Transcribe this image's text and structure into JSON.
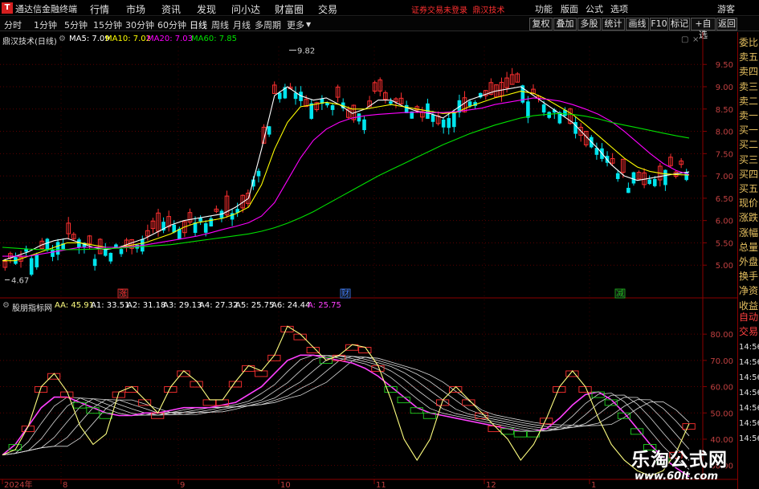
{
  "app": {
    "title": "通达信金融终端",
    "menus": [
      "行情",
      "市场",
      "资讯",
      "发现",
      "问小达",
      "财富圈",
      "交易"
    ],
    "notice": "证券交易未登录",
    "brand": "鼎汉技术",
    "right_menus": [
      "功能",
      "版面",
      "公式",
      "选项"
    ],
    "user": "游客"
  },
  "toolbar": {
    "periods": [
      "分时",
      "1分钟",
      "5分钟",
      "15分钟",
      "30分钟",
      "60分钟",
      "日线",
      "周线",
      "月线",
      "多周期",
      "更多"
    ],
    "active_period": "日线",
    "right_buttons": [
      "复权",
      "叠加",
      "多股",
      "统计",
      "画线",
      "F10",
      "标记",
      "+自选",
      "返回"
    ]
  },
  "kline": {
    "name": "鼎汉技术(日线)",
    "ma": [
      {
        "label": "MA5: 7.09",
        "color": "#ffffff"
      },
      {
        "label": "MA10: 7.02",
        "color": "#ffff00"
      },
      {
        "label": "MA20: 7.03",
        "color": "#ff00ff"
      },
      {
        "label": "MA60: 7.85",
        "color": "#00e000"
      }
    ],
    "price_ticks": [
      "9.50",
      "9.00",
      "8.50",
      "8.00",
      "7.50",
      "7.00",
      "6.50",
      "6.00",
      "5.50",
      "5.00"
    ],
    "high_label": "9.82",
    "low_label": "4.67",
    "markers": [
      {
        "text": "涨",
        "color": "#ff3030"
      },
      {
        "text": "财",
        "color": "#4080ff"
      },
      {
        "text": "减",
        "color": "#20c020"
      }
    ]
  },
  "indicator": {
    "name": "股朋指标网",
    "lines": [
      {
        "label": "AA: 45.91",
        "color": "#ffff80"
      },
      {
        "label": "A1: 33.51",
        "color": "#ffffff"
      },
      {
        "label": "A2: 31.18",
        "color": "#ffffff"
      },
      {
        "label": "A3: 29.13",
        "color": "#ffffff"
      },
      {
        "label": "A4: 27.32",
        "color": "#ffffff"
      },
      {
        "label": "A5: 25.75",
        "color": "#ffffff"
      },
      {
        "label": "A6: 24.44",
        "color": "#ffffff"
      },
      {
        "label": "A: 25.75",
        "color": "#ff40ff"
      }
    ],
    "ticks": [
      "80.00",
      "70.00",
      "60.00",
      "50.00",
      "40.00",
      "30.00"
    ]
  },
  "x_axis": {
    "labels": [
      "2024年",
      "8",
      "9",
      "10",
      "11",
      "12",
      "1"
    ]
  },
  "side_panel": {
    "items": [
      "委比",
      "卖五",
      "卖四",
      "卖三",
      "卖二",
      "卖一",
      "买一",
      "买二",
      "买三",
      "买四",
      "买五",
      "现价",
      "涨跌",
      "涨幅",
      "总量",
      "外盘",
      "换手",
      "净资",
      "收益",
      "自动",
      "交易"
    ],
    "times": [
      "14:56",
      "14:56",
      "14:56",
      "14:56",
      "14:56",
      "14:56",
      "14:56"
    ]
  },
  "watermark": {
    "title": "乐淘公式网",
    "url": "www.60lt.com"
  },
  "chart_data": [
    {
      "type": "candlestick",
      "title": "鼎汉技术(日线)",
      "yrange": [
        4.5,
        9.9
      ],
      "x_labels": [
        "2024年",
        "8",
        "9",
        "10",
        "11",
        "12",
        "1"
      ],
      "high": 9.82,
      "low": 4.67,
      "series": [
        {
          "name": "MA5",
          "last": 7.09,
          "color": "#ffffff",
          "values": [
            5.1,
            5.2,
            5.3,
            5.45,
            5.55,
            5.6,
            5.5,
            5.4,
            5.35,
            5.4,
            5.5,
            5.6,
            5.75,
            5.9,
            6.0,
            6.05,
            6.1,
            6.15,
            6.3,
            6.5,
            7.6,
            8.8,
            9.0,
            8.8,
            8.7,
            8.75,
            8.6,
            8.4,
            8.5,
            8.7,
            8.7,
            8.55,
            8.45,
            8.4,
            8.3,
            8.5,
            8.7,
            8.8,
            8.9,
            8.95,
            9.0,
            8.8,
            8.6,
            8.4,
            8.2,
            7.9,
            7.6,
            7.25,
            7.0,
            6.9,
            6.95,
            7.0,
            7.05,
            7.09
          ]
        },
        {
          "name": "MA10",
          "last": 7.02,
          "color": "#ffff00",
          "values": [
            5.1,
            5.1,
            5.2,
            5.3,
            5.4,
            5.5,
            5.5,
            5.45,
            5.4,
            5.4,
            5.45,
            5.5,
            5.6,
            5.7,
            5.85,
            5.95,
            6.0,
            6.05,
            6.15,
            6.3,
            6.8,
            7.6,
            8.2,
            8.55,
            8.6,
            8.65,
            8.6,
            8.5,
            8.5,
            8.55,
            8.6,
            8.55,
            8.5,
            8.45,
            8.4,
            8.42,
            8.55,
            8.65,
            8.75,
            8.82,
            8.9,
            8.85,
            8.72,
            8.55,
            8.38,
            8.15,
            7.9,
            7.65,
            7.4,
            7.2,
            7.1,
            7.05,
            7.03,
            7.02
          ]
        },
        {
          "name": "MA20",
          "last": 7.03,
          "color": "#ff00ff",
          "values": [
            5.2,
            5.2,
            5.2,
            5.25,
            5.3,
            5.35,
            5.4,
            5.4,
            5.4,
            5.4,
            5.42,
            5.45,
            5.5,
            5.55,
            5.6,
            5.65,
            5.72,
            5.8,
            5.87,
            5.95,
            6.1,
            6.4,
            6.9,
            7.4,
            7.8,
            8.05,
            8.2,
            8.3,
            8.35,
            8.38,
            8.4,
            8.42,
            8.43,
            8.42,
            8.42,
            8.44,
            8.48,
            8.52,
            8.6,
            8.65,
            8.7,
            8.75,
            8.72,
            8.68,
            8.6,
            8.5,
            8.38,
            8.22,
            8.0,
            7.75,
            7.5,
            7.28,
            7.12,
            7.03
          ]
        },
        {
          "name": "MA60",
          "last": 7.85,
          "color": "#00e000",
          "values": [
            5.4,
            5.38,
            5.36,
            5.35,
            5.35,
            5.35,
            5.35,
            5.36,
            5.37,
            5.38,
            5.4,
            5.42,
            5.44,
            5.46,
            5.5,
            5.54,
            5.58,
            5.62,
            5.66,
            5.7,
            5.76,
            5.84,
            5.94,
            6.06,
            6.2,
            6.36,
            6.52,
            6.68,
            6.84,
            7.0,
            7.14,
            7.28,
            7.42,
            7.56,
            7.7,
            7.82,
            7.94,
            8.04,
            8.14,
            8.22,
            8.3,
            8.35,
            8.38,
            8.4,
            8.38,
            8.34,
            8.28,
            8.2,
            8.14,
            8.08,
            8.02,
            7.96,
            7.9,
            7.85
          ]
        }
      ]
    },
    {
      "type": "line",
      "title": "股朋指标网",
      "yrange": [
        25,
        88
      ],
      "series": [
        {
          "name": "AA",
          "last": 45.91,
          "color": "#ffff80",
          "values": [
            34,
            36,
            45,
            60,
            65,
            58,
            45,
            38,
            42,
            58,
            60,
            55,
            50,
            60,
            66,
            62,
            55,
            55,
            62,
            68,
            66,
            72,
            83,
            80,
            75,
            70,
            72,
            76,
            75,
            68,
            55,
            40,
            32,
            40,
            55,
            60,
            55,
            50,
            45,
            40,
            32,
            38,
            48,
            60,
            66,
            60,
            48,
            38,
            32,
            28,
            26,
            28,
            35,
            45.91
          ]
        },
        {
          "name": "A",
          "last": 25.75,
          "color": "#ff40ff",
          "values": [
            34,
            38,
            45,
            52,
            56,
            56,
            54,
            52,
            50,
            49,
            49,
            50,
            50,
            51,
            52,
            52,
            52,
            53,
            54,
            57,
            60,
            65,
            70,
            72,
            72,
            71,
            70,
            69,
            67,
            64,
            60,
            56,
            52,
            50,
            49,
            48,
            47,
            46,
            45,
            44,
            43,
            43,
            44,
            48,
            53,
            57,
            58,
            55,
            50,
            44,
            38,
            33,
            29,
            25.75
          ]
        }
      ]
    }
  ]
}
